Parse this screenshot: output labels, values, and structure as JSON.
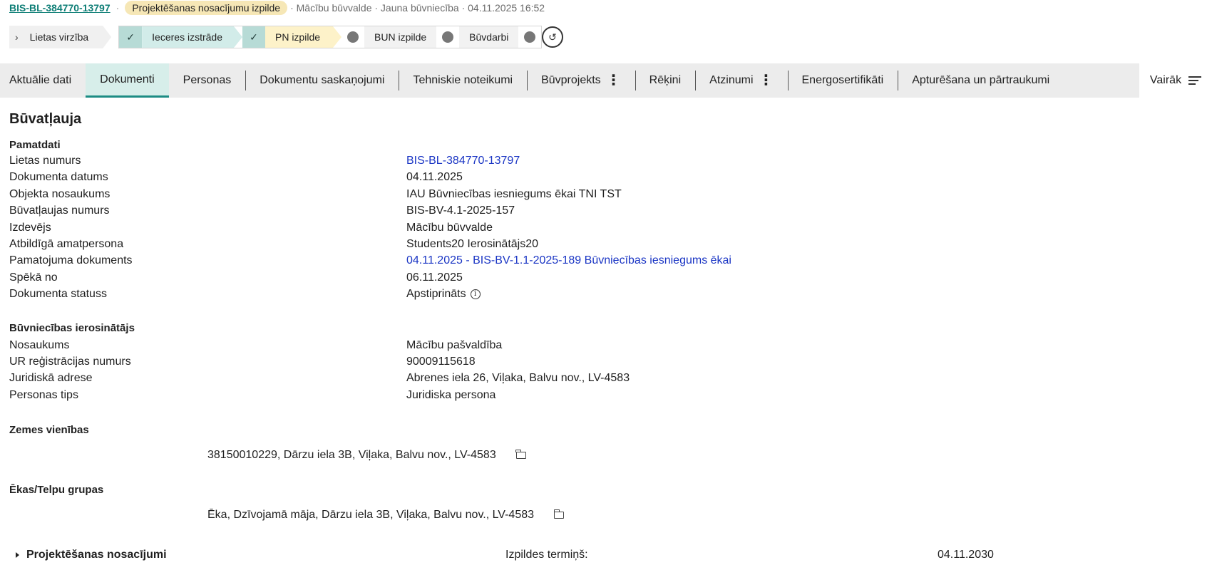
{
  "header": {
    "case_id": "BIS-BL-384770-13797",
    "stage_pill": "Projektēšanas nosacījumu izpilde",
    "meta": "· Mācību būvvalde · Jauna būvniecība · 04.11.2025 16:52"
  },
  "workflow": {
    "start_label": "Lietas virzība",
    "steps": [
      {
        "label": "Ieceres izstrāde",
        "status": "done"
      },
      {
        "label": "PN izpilde",
        "status": "current"
      },
      {
        "label": "BUN izpilde",
        "status": "pending"
      },
      {
        "label": "Būvdarbi",
        "status": "pending"
      }
    ]
  },
  "tabs": [
    {
      "label": "Aktuālie dati"
    },
    {
      "label": "Dokumenti"
    },
    {
      "label": "Personas"
    },
    {
      "label": "Dokumentu saskaņojumi"
    },
    {
      "label": "Tehniskie noteikumi"
    },
    {
      "label": "Būvprojekts"
    },
    {
      "label": "Rēķini"
    },
    {
      "label": "Atzinumi"
    },
    {
      "label": "Energosertifikāti"
    },
    {
      "label": "Apturēšana un pārtraukumi"
    }
  ],
  "more_label": "Vairāk",
  "page_title": "Būvatļauja",
  "pamatdati": {
    "title": "Pamatdati",
    "rows": [
      {
        "label": "Lietas numurs",
        "value": "BIS-BL-384770-13797"
      },
      {
        "label": "Dokumenta datums",
        "value": "04.11.2025"
      },
      {
        "label": "Objekta nosaukums",
        "value": "IAU Būvniecības iesniegums ēkai TNI TST"
      },
      {
        "label": "Būvatļaujas numurs",
        "value": "BIS-BV-4.1-2025-157"
      },
      {
        "label": "Izdevējs",
        "value": "Mācību būvvalde"
      },
      {
        "label": "Atbildīgā amatpersona",
        "value": "Students20 Ierosinātājs20"
      },
      {
        "label": "Pamatojuma dokuments",
        "value": "04.11.2025 - BIS-BV-1.1-2025-189 Būvniecības iesniegums ēkai"
      },
      {
        "label": "Spēkā no",
        "value": "06.11.2025"
      },
      {
        "label": "Dokumenta statuss",
        "value": "Apstiprināts"
      }
    ]
  },
  "ierosinatajs": {
    "title": "Būvniecības ierosinātājs",
    "rows": [
      {
        "label": "Nosaukums",
        "value": "Mācību pašvaldība"
      },
      {
        "label": "UR reģistrācijas numurs",
        "value": "90009115618"
      },
      {
        "label": "Juridiskā adrese",
        "value": "Abrenes iela 26, Viļaka, Balvu nov., LV-4583"
      },
      {
        "label": "Personas tips",
        "value": "Juridiska persona"
      }
    ]
  },
  "zemes": {
    "title": "Zemes vienības",
    "item": "38150010229, Dārzu iela 3B, Viļaka, Balvu nov., LV-4583"
  },
  "ekas": {
    "title": "Ēkas/Telpu grupas",
    "item": "Ēka, Dzīvojamā māja, Dārzu iela 3B, Viļaka, Balvu nov., LV-4583"
  },
  "projektesana": {
    "title": "Projektēšanas nosacījumi",
    "deadline_label": "Izpildes termiņš:",
    "deadline_value": "04.11.2030"
  }
}
